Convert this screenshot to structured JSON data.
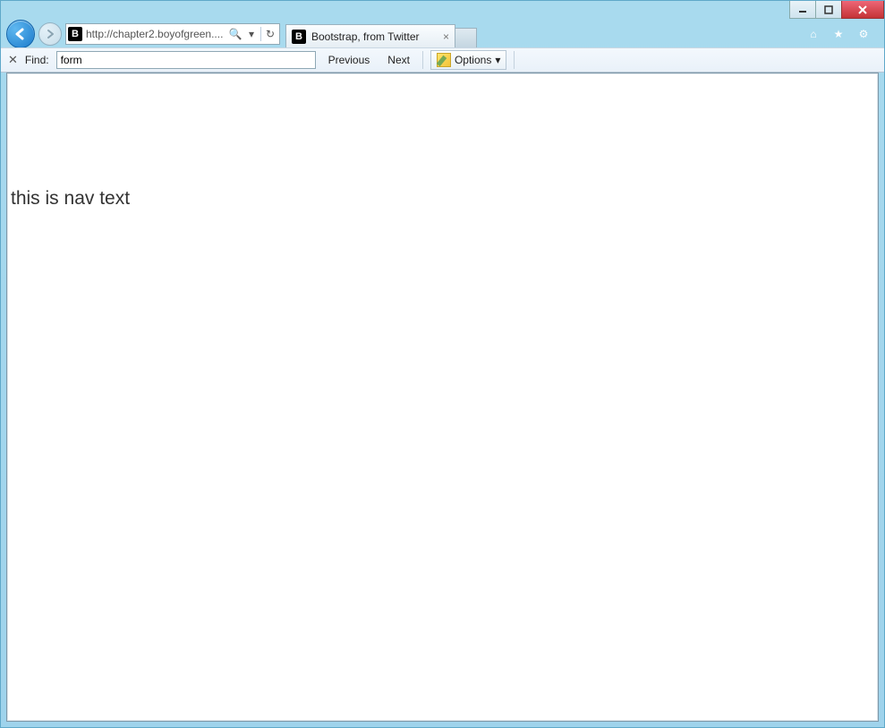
{
  "window": {
    "minimize_glyph": "–",
    "maximize_glyph": "▢",
    "close_glyph": "✕"
  },
  "address": {
    "favicon_letter": "B",
    "url_display": "http://chapter2.boyofgreen....",
    "search_glyph": "🔍",
    "dropdown_glyph": "▾",
    "refresh_glyph": "↻"
  },
  "tab": {
    "favicon_letter": "B",
    "title": "Bootstrap, from Twitter",
    "close_glyph": "×"
  },
  "toolbar_icons": {
    "home_glyph": "⌂",
    "star_glyph": "★",
    "gear_glyph": "⚙"
  },
  "findbar": {
    "close_glyph": "✕",
    "label": "Find:",
    "value": "form",
    "prev_label": "Previous",
    "next_label": "Next",
    "options_label": "Options",
    "options_dd_glyph": "▾"
  },
  "page": {
    "nav_text": "this is nav text"
  }
}
